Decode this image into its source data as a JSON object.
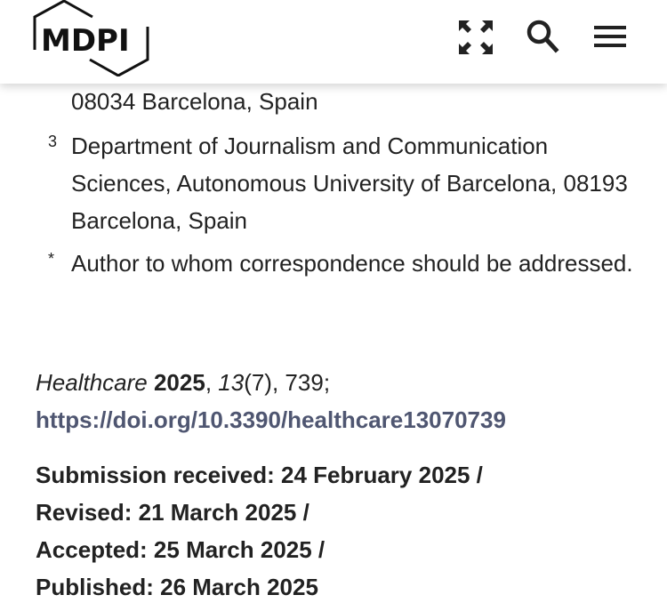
{
  "header": {
    "logo_text": "MDPI",
    "icons": [
      "expand-icon",
      "search-icon",
      "hamburger-menu-icon"
    ]
  },
  "affiliations": {
    "partial_line": "08034 Barcelona, Spain",
    "items": [
      {
        "mark": "3",
        "text": "Department of Journalism and Communication Sciences, Autonomous University of Barcelona, 08193 Barcelona, Spain"
      },
      {
        "mark": "*",
        "text": "Author to whom correspondence should be addressed."
      }
    ]
  },
  "citation": {
    "journal": "Healthcare",
    "year": "2025",
    "volume": "13",
    "issue": "(7)",
    "article": "739",
    "doi_url": "https://doi.org/10.3390/healthcare13070739"
  },
  "dates": {
    "received": "Submission received: 24 February 2025 /",
    "revised": "Revised: 21 March 2025 /",
    "accepted": "Accepted: 25 March 2025 /",
    "published": "Published: 26 March 2025"
  },
  "colors": {
    "link": "#4f5671",
    "text": "#222222",
    "logo": "#111111"
  }
}
